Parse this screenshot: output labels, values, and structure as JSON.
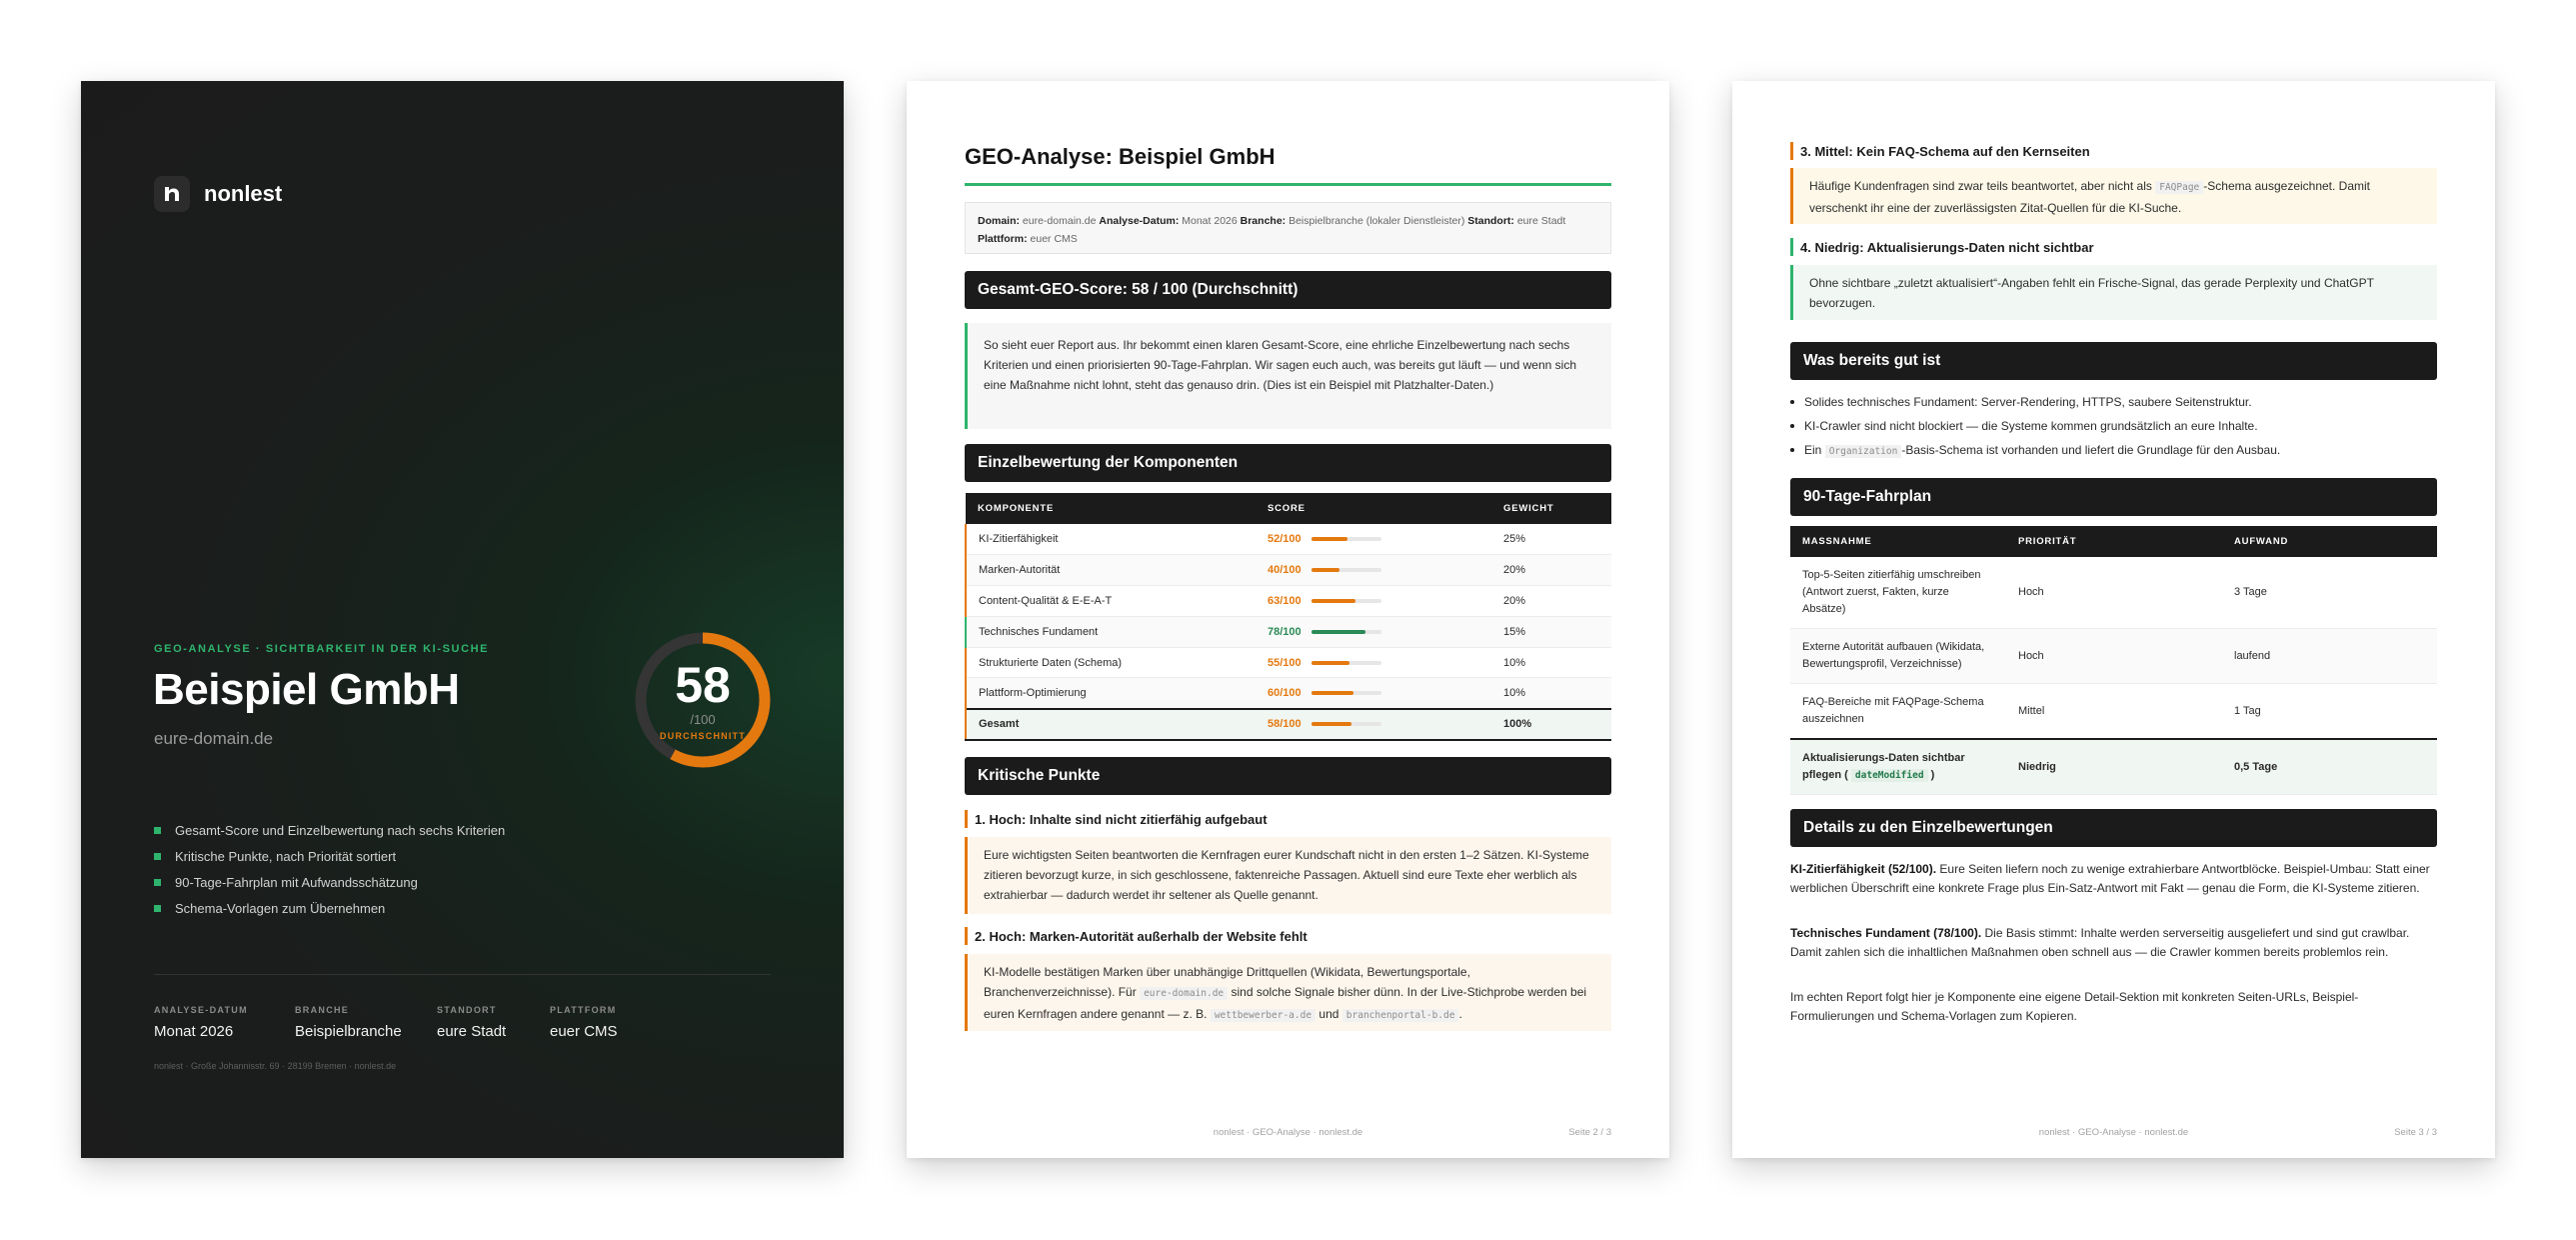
{
  "cover": {
    "brand": "nonlest",
    "eyebrow": "GEO-ANALYSE · SICHTBARKEIT IN DER KI-SUCHE",
    "title": "Beispiel GmbH",
    "domain": "eure-domain.de",
    "score": "58",
    "score_max": "/100",
    "score_label": "DURCHSCHNITT",
    "score_value": 58,
    "bullets": [
      "Gesamt-Score und Einzelbewertung nach sechs Kriterien",
      "Kritische Punkte, nach Priorität sortiert",
      "90-Tage-Fahrplan mit Aufwandsschätzung",
      "Schema-Vorlagen zum Übernehmen"
    ],
    "meta": [
      {
        "label": "ANALYSE-DATUM",
        "value": "Monat 2026"
      },
      {
        "label": "BRANCHE",
        "value": "Beispielbranche"
      },
      {
        "label": "STANDORT",
        "value": "eure Stadt"
      },
      {
        "label": "PLATTFORM",
        "value": "euer CMS"
      }
    ],
    "footer": "nonlest · Große Johannisstr. 69 · 28199 Bremen · nonlest.de"
  },
  "colors": {
    "accent_green": "#2fb46d",
    "accent_orange": "#e4790f",
    "dark": "#1b1b1b"
  },
  "page2": {
    "title": "GEO-Analyse: Beispiel GmbH",
    "meta": {
      "domain_label": "Domain:",
      "domain": "eure-domain.de",
      "date_label": "Analyse-Datum:",
      "date": "Monat 2026",
      "branch_label": "Branche:",
      "branch": "Beispielbranche (lokaler Dienstleister)",
      "location_label": "Standort:",
      "location": "eure Stadt",
      "platform_label": "Plattform:",
      "platform": "euer CMS"
    },
    "score_header": "Gesamt-GEO-Score: 58 / 100 (Durchschnitt)",
    "intro": "So sieht euer Report aus. Ihr bekommt einen klaren Gesamt-Score, eine ehrliche Einzelbewertung nach sechs Kriterien und einen priorisierten 90-Tage-Fahrplan. Wir sagen euch auch, was bereits gut läuft — und wenn sich eine Maßnahme nicht lohnt, steht das genauso drin. (Dies ist ein Beispiel mit Platzhalter-Daten.)",
    "components_header": "Einzelbewertung der Komponenten",
    "table_headers": [
      "KOMPONENTE",
      "SCORE",
      "GEWICHT"
    ],
    "components": [
      {
        "name": "KI-Zitierfähigkeit",
        "score": "52/100",
        "value": 52,
        "weight": "25%"
      },
      {
        "name": "Marken-Autorität",
        "score": "40/100",
        "value": 40,
        "weight": "20%"
      },
      {
        "name": "Content-Qualität & E-E-A-T",
        "score": "63/100",
        "value": 63,
        "weight": "20%"
      },
      {
        "name": "Technisches Fundament",
        "score": "78/100",
        "value": 78,
        "weight": "15%"
      },
      {
        "name": "Strukturierte Daten (Schema)",
        "score": "55/100",
        "value": 55,
        "weight": "10%"
      },
      {
        "name": "Plattform-Optimierung",
        "score": "60/100",
        "value": 60,
        "weight": "10%"
      }
    ],
    "total": {
      "name": "Gesamt",
      "score": "58/100",
      "value": 58,
      "weight": "100%"
    },
    "critical_header": "Kritische Punkte",
    "point1_title": "1. Hoch: Inhalte sind nicht zitierfähig aufgebaut",
    "point1_text": "Eure wichtigsten Seiten beantworten die Kernfragen eurer Kundschaft nicht in den ersten 1–2 Sätzen. KI-Systeme zitieren bevorzugt kurze, in sich geschlossene, faktenreiche Passagen. Aktuell sind eure Texte eher werblich als extrahierbar — dadurch werdet ihr seltener als Quelle genannt.",
    "point2_title": "2. Hoch: Marken-Autorität außerhalb der Website fehlt",
    "point2_text_a": "KI-Modelle bestätigen Marken über unabhängige Drittquellen (Wikidata, Bewertungsportale, Branchenverzeichnisse). Für",
    "point2_code_a": "eure-domain.de",
    "point2_text_b": "sind solche Signale bisher dünn. In der Live-Stichprobe werden bei euren Kernfragen andere genannt — z. B.",
    "point2_code_b": "wettbewerber-a.de",
    "point2_text_c": "und",
    "point2_code_c": "branchenportal-b.de",
    "point2_text_d": ".",
    "footer_center": "nonlest · GEO-Analyse · nonlest.de",
    "footer_page": "Seite 2 / 3"
  },
  "page3": {
    "point3_title": "3. Mittel: Kein FAQ-Schema auf den Kernseiten",
    "point3_text_a": "Häufige Kundenfragen sind zwar teils beantwortet, aber nicht als",
    "point3_code": "FAQPage",
    "point3_text_b": "-Schema ausgezeichnet. Damit verschenkt ihr eine der zuverlässigsten Zitat-Quellen für die KI-Suche.",
    "point4_title": "4. Niedrig: Aktualisierungs-Daten nicht sichtbar",
    "point4_text": "Ohne sichtbare „zuletzt aktualisiert“-Angaben fehlt ein Frische-Signal, das gerade Perplexity und ChatGPT bevorzugen.",
    "good_header": "Was bereits gut ist",
    "good_1": "Solides technisches Fundament: Server-Rendering, HTTPS, saubere Seitenstruktur.",
    "good_2": "KI-Crawler sind nicht blockiert — die Systeme kommen grundsätzlich an eure Inhalte.",
    "good_3_a": "Ein",
    "good_3_code": "Organization",
    "good_3_b": "-Basis-Schema ist vorhanden und liefert die Grundlage für den Ausbau.",
    "plan_header": "90-Tage-Fahrplan",
    "plan_headers": [
      "MASSNAHME",
      "PRIORITÄT",
      "AUFWAND"
    ],
    "plan": [
      {
        "action": "Top-5-Seiten zitierfähig umschreiben (Antwort zuerst, Fakten, kurze Absätze)",
        "priority": "Hoch",
        "effort": "3 Tage"
      },
      {
        "action": "Externe Autorität aufbauen (Wikidata, Bewertungsprofil, Verzeichnisse)",
        "priority": "Hoch",
        "effort": "laufend"
      },
      {
        "action": "FAQ-Bereiche mit FAQPage-Schema auszeichnen",
        "priority": "Mittel",
        "effort": "1 Tag"
      }
    ],
    "plan_hl_action_a": "Aktualisierungs-Daten sichtbar pflegen (",
    "plan_hl_code": "dateModified",
    "plan_hl_action_b": ")",
    "plan_hl_priority": "Niedrig",
    "plan_hl_effort": "0,5 Tage",
    "details_header": "Details zu den Einzelbewertungen",
    "detail1_label": "KI-Zitierfähigkeit (52/100).",
    "detail1_text": "Eure Seiten liefern noch zu wenige extrahierbare Antwortblöcke. Beispiel-Umbau: Statt einer werblichen Überschrift eine konkrete Frage plus Ein-Satz-Antwort mit Fakt — genau die Form, die KI-Systeme zitieren.",
    "detail2_label": "Technisches Fundament (78/100).",
    "detail2_text": "Die Basis stimmt: Inhalte werden serverseitig ausgeliefert und sind gut crawlbar. Damit zahlen sich die inhaltlichen Maßnahmen oben schnell aus — die Crawler kommen bereits problemlos rein.",
    "detail3_text": "Im echten Report folgt hier je Komponente eine eigene Detail-Sektion mit konkreten Seiten-URLs, Beispiel-Formulierungen und Schema-Vorlagen zum Kopieren.",
    "footer_center": "nonlest · GEO-Analyse · nonlest.de",
    "footer_page": "Seite 3 / 3"
  }
}
